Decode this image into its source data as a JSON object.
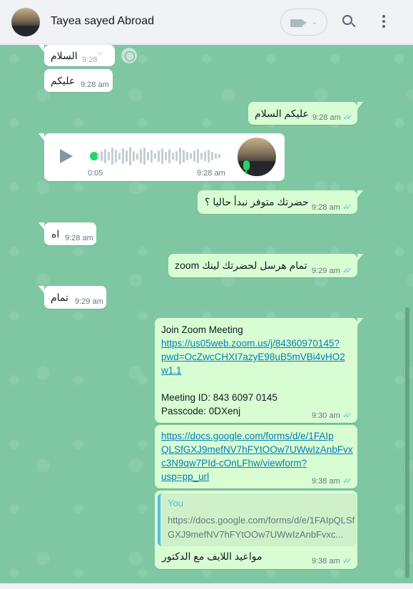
{
  "header": {
    "contact_name": "Tayea sayed Abroad",
    "icons": [
      "avatar",
      "video-call-icon",
      "chevron-down-icon",
      "search-icon",
      "menu-icon"
    ]
  },
  "colors": {
    "chat_bg": "#7fc7a3",
    "incoming_bubble": "#ffffff",
    "outgoing_bubble": "#d9fdd3",
    "link": "#027eb5",
    "read_tick": "#53bdeb",
    "accent_green": "#25d366"
  },
  "messages": [
    {
      "direction": "in",
      "text": "السلام",
      "time": "9:28"
    },
    {
      "direction": "in",
      "text": "عليكم",
      "time": "9:28 am"
    },
    {
      "direction": "out",
      "text": "عليكم السلام",
      "time": "9:28 am",
      "status": "read"
    },
    {
      "direction": "out",
      "type": "voice",
      "duration": "0:05",
      "time": "9:28 am"
    },
    {
      "direction": "out",
      "text": "حضرتك متوفر نبدأ حاليا ؟",
      "time": "9:28 am",
      "status": "read"
    },
    {
      "direction": "in",
      "text": "اه",
      "time": "9:28 am"
    },
    {
      "direction": "out",
      "text": "تمام هرسل لحضرتك لينك zoom",
      "time": "9:29 am",
      "status": "read"
    },
    {
      "direction": "in",
      "text": "تمام",
      "time": "9:29 am"
    },
    {
      "direction": "out",
      "title": "Join Zoom Meeting",
      "link_lines": [
        "https://us05web.zoom.us/j/84360970145?",
        "pwd=OcZwcCHXI7azyE98uB5mVBi4vHO2",
        "w1.1"
      ],
      "meeting_id": "Meeting ID: 843 6097 0145",
      "passcode": "Passcode: 0DXenj",
      "time": "9:30 am",
      "status": "read"
    },
    {
      "direction": "out",
      "link_lines": [
        "https://docs.google.com/forms/d/e/1FAIp",
        "QLSfGXJ9mefNV7hFYtOOw7UWwIzAnbFvx",
        "c3N9qw7PId-cOnLFhw/viewform?",
        "usp=pp_url"
      ],
      "time": "9:38 am",
      "status": "read"
    },
    {
      "direction": "out",
      "quote_author": "You",
      "quote_text": "https://docs.google.com/forms/d/e/1FAIpQLSfGXJ9mefNV7hFYtOOw7UWwIzAnbFvxc...",
      "text": "مواعيد اللايف مع الدكتور",
      "time": "9:38 am",
      "status": "read"
    }
  ]
}
